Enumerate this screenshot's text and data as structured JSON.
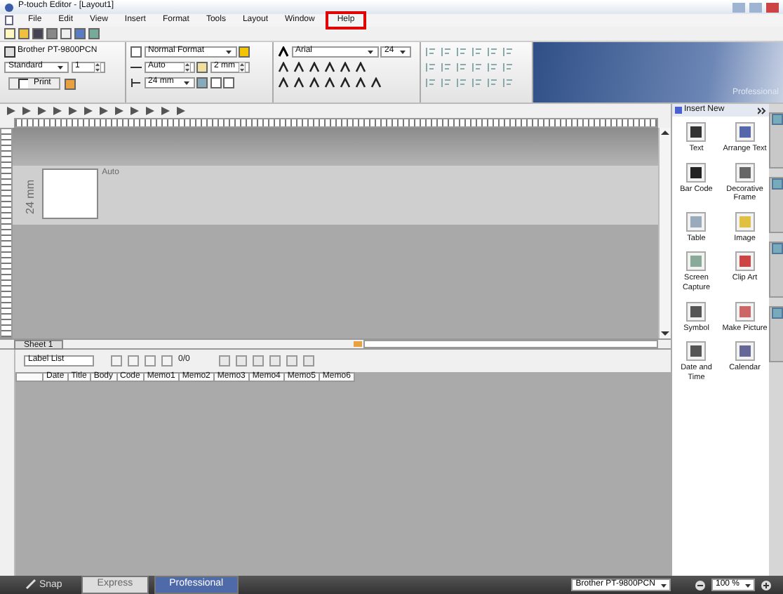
{
  "window": {
    "title": "P-touch Editor - [Layout1]"
  },
  "menu": [
    {
      "label": "File",
      "marked": false
    },
    {
      "label": "Edit",
      "marked": false
    },
    {
      "label": "View",
      "marked": false
    },
    {
      "label": "Insert",
      "marked": false
    },
    {
      "label": "Format",
      "marked": false
    },
    {
      "label": "Tools",
      "marked": false
    },
    {
      "label": "Layout",
      "marked": false
    },
    {
      "label": "Window",
      "marked": false
    },
    {
      "label": "Help",
      "marked": true
    }
  ],
  "printer_panel": {
    "printer": "Brother PT-9800PCN",
    "mode": "Standard",
    "copies": "1",
    "print_button": "Print"
  },
  "format_panel": {
    "format": "Normal Format",
    "length": "Auto",
    "margin": "2 mm",
    "tape_width": "24 mm"
  },
  "font_panel": {
    "font": "Arial",
    "size": "24"
  },
  "banner": {
    "label": "Professional"
  },
  "canvas": {
    "tape_width": "24 mm",
    "length": "Auto",
    "sheet_tab": "Sheet 1"
  },
  "label_list": {
    "title": "Label List",
    "counter": "0/0",
    "columns": [
      "Date",
      "Title",
      "Body",
      "Code",
      "Memo1",
      "Memo2",
      "Memo3",
      "Memo4",
      "Memo5",
      "Memo6"
    ]
  },
  "insert_panel": {
    "title": "Insert New",
    "items": [
      "Text",
      "Arrange Text",
      "Bar Code",
      "Decorative Frame",
      "Table",
      "Image",
      "Screen Capture",
      "Clip Art",
      "Symbol",
      "Make Picture",
      "Date and Time",
      "Calendar"
    ]
  },
  "status_bar": {
    "snap": "Snap",
    "modes": [
      {
        "label": "Express",
        "selected": false
      },
      {
        "label": "Professional",
        "selected": true
      }
    ],
    "printer": "Brother PT-9800PCN",
    "zoom": "100 %"
  }
}
